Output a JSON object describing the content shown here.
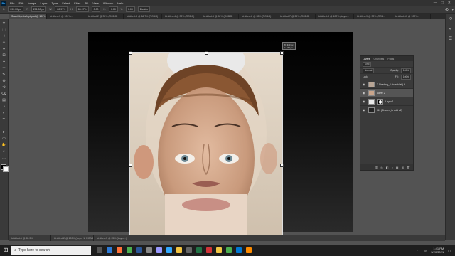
{
  "menubar": {
    "logo": "Ps",
    "items": [
      "File",
      "Edit",
      "Image",
      "Layer",
      "Type",
      "Select",
      "Filter",
      "3D",
      "View",
      "Window",
      "Help"
    ],
    "window_controls": [
      "—",
      "□",
      "✕"
    ]
  },
  "optionsbar": {
    "fields": [
      {
        "label": "X:",
        "value": "290.00 px"
      },
      {
        "label": "Y:",
        "value": "201.50 px"
      },
      {
        "label": "W:",
        "value": "80.97%"
      },
      {
        "label": "H:",
        "value": "80.97%"
      },
      {
        "label": "",
        "value": "0.00"
      },
      {
        "label": "H:",
        "value": "0.00"
      },
      {
        "label": "V:",
        "value": "0.00"
      },
      {
        "label": "",
        "value": "Bicubic"
      }
    ],
    "cancel": "⊘",
    "commit": "✓"
  },
  "tabs": [
    {
      "label": "SnapObjectsKept.psd @ 100% (Layer 1, RGB/8#)",
      "active": true
    },
    {
      "label": "Untitled-1 @ 100%...",
      "active": false
    },
    {
      "label": "Untitled-2 @ 33% (RGB/8)",
      "active": false
    },
    {
      "label": "Untitled-3 @ 66.7% (RGB/8)",
      "active": false
    },
    {
      "label": "Untitled-4 @ 33% (RGB/8)",
      "active": false
    },
    {
      "label": "Untitled-5 @ 50% (RGB/8)",
      "active": false
    },
    {
      "label": "Untitled-6 @ 33% (RGB/8)",
      "active": false
    },
    {
      "label": "Untitled-7 @ 25% (RGB/8)",
      "active": false
    },
    {
      "label": "Untitled-8 @ 100% (Layer...",
      "active": false
    },
    {
      "label": "Untitled-9 @ 33% (RGB...",
      "active": false
    },
    {
      "label": "Untitled-10 @ 100%...",
      "active": false
    }
  ],
  "tools": [
    "move-icon",
    "marquee-icon",
    "lasso-icon",
    "magic-wand-icon",
    "crop-icon",
    "frame-icon",
    "eyedropper-icon",
    "healing-icon",
    "brush-icon",
    "stamp-icon",
    "history-brush-icon",
    "eraser-icon",
    "gradient-icon",
    "blur-icon",
    "dodge-icon",
    "pen-icon",
    "type-icon",
    "path-select-icon",
    "shape-icon",
    "hand-icon",
    "zoom-icon",
    "more-icon"
  ],
  "tool_glyphs": [
    "✥",
    "⬚",
    "ℓ",
    "✧",
    "⌗",
    "⊡",
    "⌖",
    "✚",
    "✎",
    "⊕",
    "⟲",
    "⌫",
    "▤",
    "◔",
    "◐",
    "✒",
    "T",
    "➤",
    "▭",
    "✋",
    "⌕",
    "…"
  ],
  "tooltip": {
    "w": "W: 440 px",
    "h": "H: 440 px"
  },
  "layers_panel": {
    "tabs": [
      {
        "label": "Layers",
        "active": true
      },
      {
        "label": "Channels",
        "active": false
      },
      {
        "label": "Paths",
        "active": false
      }
    ],
    "kind": "Kind",
    "blend_mode": "Normal",
    "opacity_label": "Opacity:",
    "opacity_value": "100%",
    "lock_label": "Lock:",
    "fill_label": "Fill:",
    "fill_value": "100%",
    "layers": [
      {
        "name": "3 Shading_2 (to add all) K",
        "active": false,
        "thumb": "#b8a595",
        "mask": false
      },
      {
        "name": "Layer 2",
        "active": true,
        "thumb": "#c9a58b",
        "mask": false
      },
      {
        "name": "Layer 1",
        "active": false,
        "thumb": "#e8e8e8",
        "mask": true
      },
      {
        "name": "HK (Shader_to add all)",
        "active": false,
        "thumb": "#222222",
        "mask": false
      }
    ],
    "footer_icons": [
      "⛓",
      "fx",
      "◧",
      "◑",
      "▣",
      "⊞",
      "🗑"
    ]
  },
  "doc_tabs": [
    "Untitled-1 @ 65.3%",
    "Untitled-2 @ 100% (Layer 1, RGB/8#)",
    "Untitled-3 @ 25% (Layer...)"
  ],
  "taskbar": {
    "start_icon": "⊞",
    "search_placeholder": "Type here to search",
    "apps": [
      {
        "name": "task-view",
        "color": "#555555"
      },
      {
        "name": "edge",
        "color": "#2d7ad6"
      },
      {
        "name": "firefox",
        "color": "#ff7139"
      },
      {
        "name": "chrome",
        "color": "#4caf50"
      },
      {
        "name": "word",
        "color": "#2b579a"
      },
      {
        "name": "settings",
        "color": "#888888"
      },
      {
        "name": "premiere",
        "color": "#9999ff"
      },
      {
        "name": "photoshop",
        "color": "#31a8ff"
      },
      {
        "name": "explorer",
        "color": "#f4c542"
      },
      {
        "name": "media",
        "color": "#666666"
      },
      {
        "name": "excel",
        "color": "#217346"
      },
      {
        "name": "app-red",
        "color": "#d13438"
      },
      {
        "name": "app-yellow",
        "color": "#f2c744"
      },
      {
        "name": "chrome-2",
        "color": "#4caf50"
      },
      {
        "name": "app-blue",
        "color": "#0078d4"
      },
      {
        "name": "app-orange",
        "color": "#ff8c00"
      }
    ],
    "time": "1:41 PM",
    "date": "5/20/2021"
  }
}
